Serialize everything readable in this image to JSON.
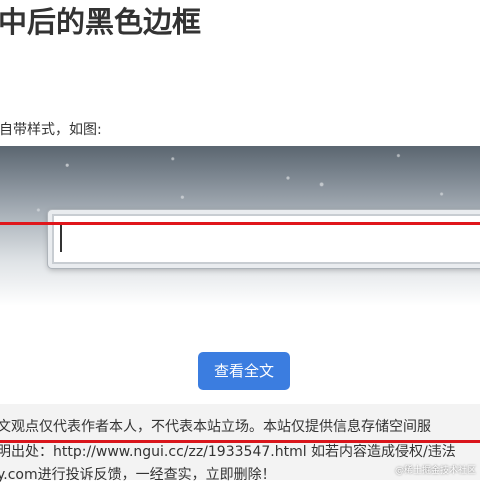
{
  "article": {
    "heading": "中后的黑色边框",
    "caption": "自带样式，如图:"
  },
  "actions": {
    "view_all_label": "查看全文"
  },
  "disclaimer": {
    "line1": "文观点仅代表作者本人，不代表本站立场。本站仅提供信息存储空间服",
    "line2": "明出处：http://www.ngui.cc/zz/1933547.html 如若内容造成侵权/违法",
    "line3": "y.com进行投诉反馈，一经查实，立即删除！"
  },
  "watermark": {
    "text": "@稀土掘金技术社区"
  },
  "colors": {
    "accent_button": "#3b7de0",
    "annotation_red": "#e0161b",
    "disclaimer_bg": "#f3f3f3"
  }
}
